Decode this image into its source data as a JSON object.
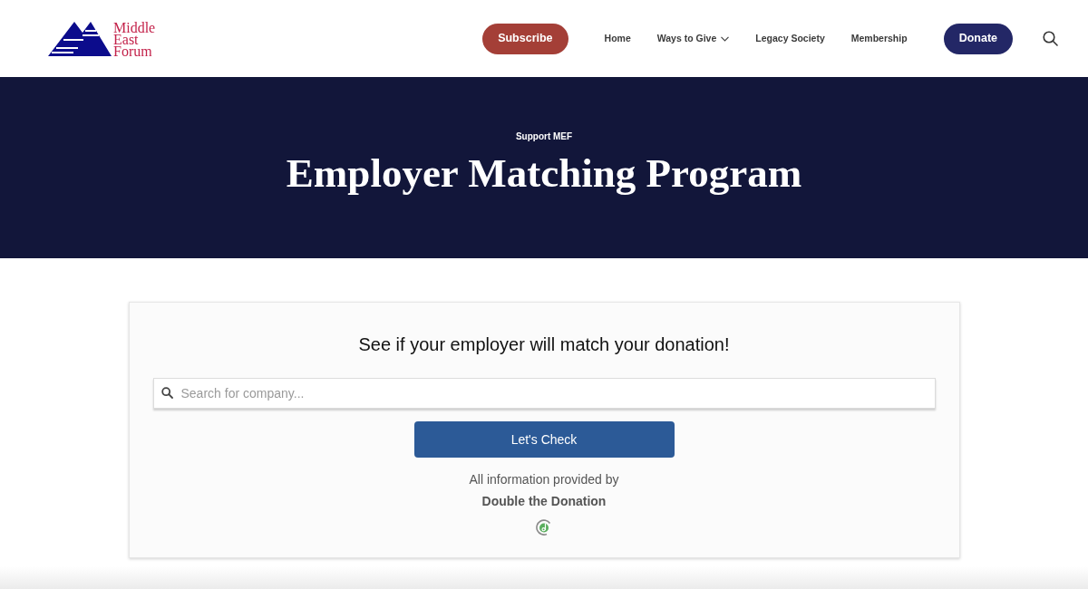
{
  "header": {
    "logo": {
      "text": "Middle East Forum"
    },
    "nav": [
      {
        "label": "Subscribe",
        "kind": "button",
        "color": "#a43f37"
      },
      {
        "label": "Home",
        "kind": "link"
      },
      {
        "label": "Ways to Give",
        "kind": "dropdown"
      },
      {
        "label": "Legacy Society",
        "kind": "link"
      },
      {
        "label": "Membership",
        "kind": "link"
      },
      {
        "label": "Donate",
        "kind": "button",
        "color": "#232766"
      }
    ]
  },
  "hero": {
    "eyebrow": "Support MEF",
    "title": "Employer Matching Program"
  },
  "match_widget": {
    "heading": "See if your employer will match your donation!",
    "search": {
      "placeholder": "Search for company..."
    },
    "button": "Let's Check",
    "credit": "All information provided by",
    "provider": "Double the Donation"
  }
}
